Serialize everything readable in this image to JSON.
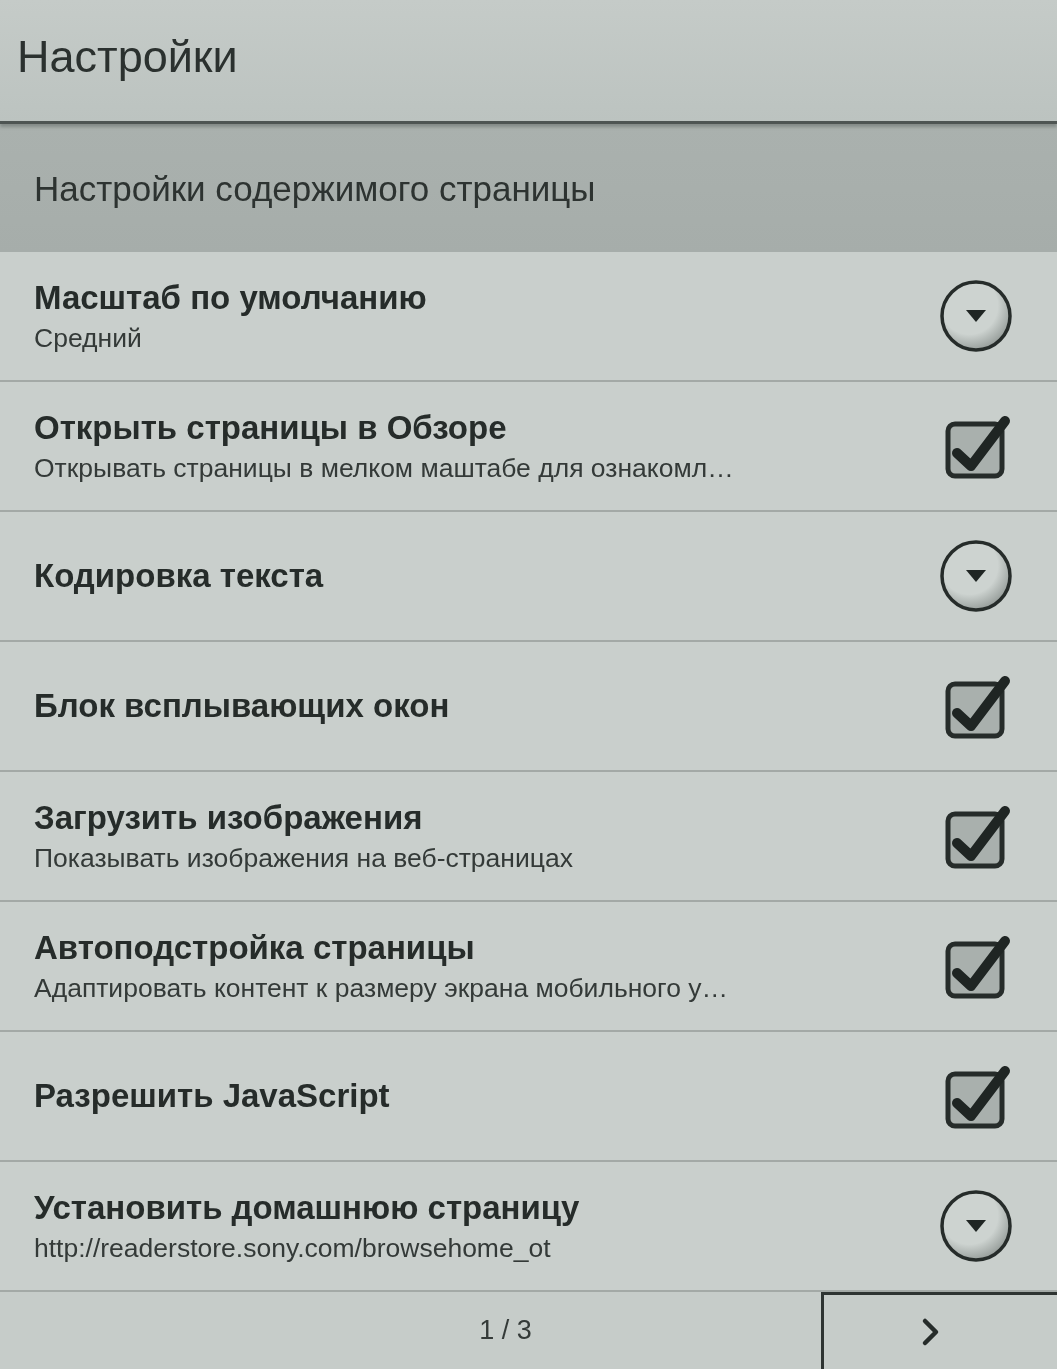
{
  "header": {
    "title": "Настройки"
  },
  "section": {
    "title": "Настройки содержимого страницы"
  },
  "settings": [
    {
      "kind": "dropdown",
      "title": "Масштаб по умолчанию",
      "subtitle": "Средний"
    },
    {
      "kind": "checkbox",
      "title": "Открыть страницы в Обзоре",
      "subtitle": "Открывать страницы в мелком маштабе для ознакомл…",
      "checked": true
    },
    {
      "kind": "dropdown",
      "title": "Кодировка текста"
    },
    {
      "kind": "checkbox",
      "title": "Блок всплывающих окон",
      "checked": true
    },
    {
      "kind": "checkbox",
      "title": "Загрузить изображения",
      "subtitle": "Показывать изображения на веб-страницах",
      "checked": true
    },
    {
      "kind": "checkbox",
      "title": "Автоподстройка страницы",
      "subtitle": "Адаптировать контент к размеру экрана мобильного у…",
      "checked": true
    },
    {
      "kind": "checkbox",
      "title": "Разрешить JavaScript",
      "checked": true
    },
    {
      "kind": "dropdown",
      "title": "Установить домашнюю страницу",
      "subtitle": "http://readerstore.sony.com/browsehome_ot"
    }
  ],
  "pager": {
    "page": "1 / 3"
  }
}
